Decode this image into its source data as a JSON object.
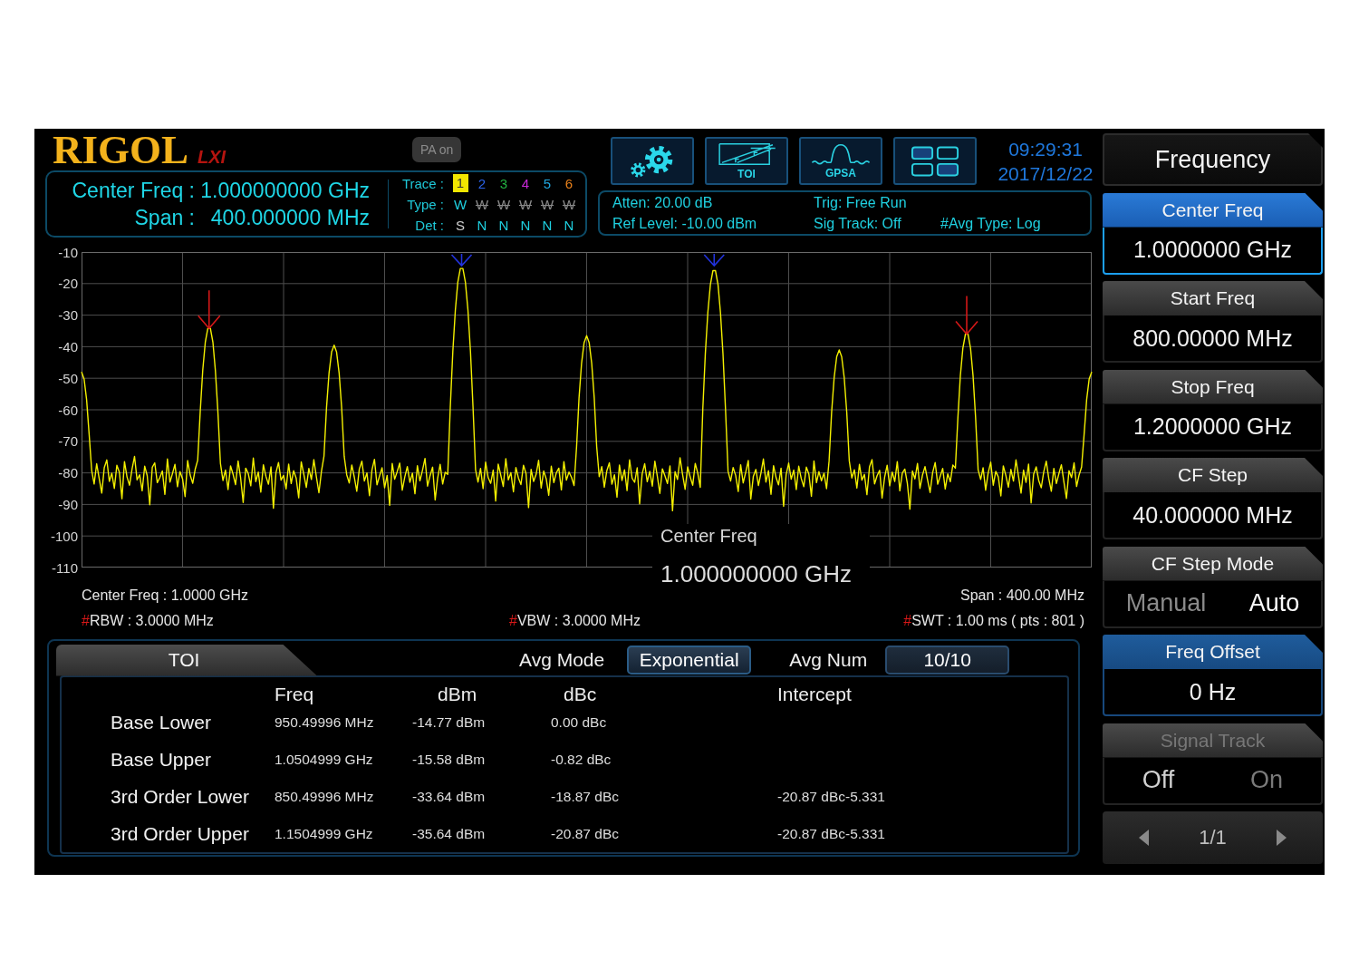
{
  "header": {
    "logo": "RIGOL",
    "logo_badge": "LXI",
    "pa_indicator": "PA on",
    "toolbar": [
      {
        "kind": "settings"
      },
      {
        "kind": "toi",
        "label": "TOI"
      },
      {
        "kind": "gpsa",
        "label": "GPSA"
      },
      {
        "kind": "layout"
      }
    ],
    "time": "09:29:31",
    "date": "2017/12/22"
  },
  "info": {
    "center_freq": {
      "label": "Center Freq :",
      "value": "1.000000000 GHz"
    },
    "span": {
      "label": "Span :",
      "value": "400.000000 MHz"
    },
    "row_labels": [
      "Trace :",
      "Type :",
      "Det :"
    ],
    "traces": [
      {
        "number": "1",
        "color": "#f2e600",
        "selected": true,
        "visible": true,
        "type": "W",
        "det": "S"
      },
      {
        "number": "2",
        "color": "#2a62e8",
        "selected": false,
        "visible": false,
        "type": "W",
        "det": "N"
      },
      {
        "number": "3",
        "color": "#22b040",
        "selected": false,
        "visible": false,
        "type": "W",
        "det": "N"
      },
      {
        "number": "4",
        "color": "#c828d8",
        "selected": false,
        "visible": false,
        "type": "W",
        "det": "N"
      },
      {
        "number": "5",
        "color": "#20a8e0",
        "selected": false,
        "visible": false,
        "type": "W",
        "det": "N"
      },
      {
        "number": "6",
        "color": "#e8801a",
        "selected": false,
        "visible": false,
        "type": "W",
        "det": "N"
      }
    ],
    "status": [
      [
        "Atten: 20.00 dB",
        "Ref Level: -10.00 dBm"
      ],
      [
        "Trig: Free Run",
        "Sig Track: Off"
      ],
      [
        "#Avg Type: Log"
      ]
    ]
  },
  "plot": {
    "chart_data": {
      "type": "line",
      "grid": true,
      "ylim": [
        -110,
        -10
      ],
      "yticks": [
        -10,
        -20,
        -30,
        -40,
        -50,
        -60,
        -70,
        -80,
        -90,
        -100,
        -110
      ],
      "categories": [
        null,
        null,
        null,
        null,
        null,
        null,
        null,
        null,
        null,
        null,
        null,
        null,
        null,
        null,
        null,
        null,
        null,
        null,
        null,
        null,
        null,
        null,
        null,
        null,
        null,
        null,
        null,
        null,
        null,
        null,
        null,
        null,
        null,
        null,
        null,
        null,
        null,
        null,
        null,
        null,
        null,
        null,
        null,
        null,
        null,
        null,
        null,
        null,
        null,
        null,
        null,
        null,
        null,
        null,
        null,
        null,
        null,
        null,
        null,
        null,
        null,
        null,
        null,
        null,
        null,
        null,
        null,
        null,
        null,
        null,
        null,
        null,
        null,
        null,
        null,
        null,
        null,
        null,
        null,
        null,
        null,
        null,
        null,
        null,
        null,
        null,
        null,
        null,
        null,
        null,
        null,
        null,
        null,
        null,
        null,
        null,
        null,
        null,
        null,
        null,
        null,
        null,
        null,
        null,
        null,
        null,
        null,
        null,
        null,
        null,
        null,
        null,
        null,
        null,
        null,
        null,
        null,
        null,
        null,
        null,
        null,
        null,
        null,
        null,
        null,
        null,
        null,
        null,
        null,
        null,
        null,
        null,
        null,
        null,
        null,
        null,
        null,
        null,
        null,
        null,
        null,
        null,
        null,
        null,
        null,
        null,
        null,
        null,
        null,
        null,
        null,
        null,
        null,
        null,
        null,
        null,
        null,
        null,
        null,
        null,
        null,
        null,
        null,
        null,
        null,
        null,
        null,
        null,
        null,
        null,
        null,
        null,
        null,
        null,
        null,
        null,
        null,
        null,
        null,
        null,
        null,
        null,
        null,
        null,
        null,
        null,
        null,
        null,
        null,
        null,
        null,
        null,
        null,
        null,
        null,
        null,
        null,
        null,
        null,
        null,
        null,
        null,
        null,
        null,
        null,
        null,
        null,
        null,
        null,
        null,
        null,
        null,
        null,
        null,
        null,
        null,
        null,
        null,
        null,
        null,
        null,
        null,
        null,
        null,
        null,
        null,
        null,
        null,
        null,
        null,
        null,
        null,
        null,
        null,
        null,
        null,
        null,
        null,
        null,
        null,
        null,
        null,
        null,
        null,
        null,
        null,
        null,
        null,
        null,
        null,
        null,
        null,
        null,
        null,
        null,
        null,
        null,
        null,
        null,
        null,
        null,
        null,
        null,
        null,
        null,
        null,
        null,
        null,
        null,
        null,
        null,
        null,
        null,
        null,
        null,
        null,
        null,
        null,
        null,
        null,
        null,
        null,
        null,
        null,
        null,
        null,
        null,
        null,
        null,
        null,
        null,
        null,
        null,
        null,
        null,
        null,
        null,
        null,
        null,
        null,
        null,
        null,
        null,
        null,
        null,
        null,
        null,
        null,
        null,
        null,
        null,
        null,
        null,
        null,
        null,
        null,
        null,
        null,
        null,
        null,
        null,
        null,
        null,
        null,
        null,
        null,
        null,
        null,
        null,
        null,
        null,
        null,
        null,
        null,
        null,
        null,
        null,
        null,
        null,
        null,
        null,
        null,
        null,
        null,
        null,
        null,
        null,
        null,
        null,
        null,
        null,
        null,
        null,
        null,
        null,
        null,
        null,
        null,
        null,
        null,
        null,
        null,
        null,
        null,
        null,
        null,
        null,
        null,
        null,
        null,
        null,
        null,
        null,
        null,
        null,
        null,
        null,
        null,
        null,
        null,
        null,
        null,
        null,
        null,
        null,
        null,
        null,
        null,
        null,
        null,
        null,
        null,
        null,
        null,
        null,
        null,
        null,
        null,
        null,
        null,
        null
      ],
      "series": [
        {
          "color": "#f4f000",
          "values": [
            -48,
            -50.2,
            -56.8,
            -67.8,
            -79.2,
            -83.5,
            -77.1,
            -81.8,
            -86.4,
            -78.3,
            -75.9,
            -82.7,
            -80.1,
            -84.9,
            -77.6,
            -79.8,
            -88.2,
            -76.4,
            -81.3,
            -83.9,
            -78.7,
            -74.8,
            -82.2,
            -80.6,
            -85.7,
            -77.9,
            -80.9,
            -90.1,
            -78.2,
            -76.8,
            -83.1,
            -81.5,
            -79.4,
            -86.8,
            -75.6,
            -82.9,
            -80.3,
            -77.3,
            -84.4,
            -79.6,
            -81.9,
            -87.5,
            -76.1,
            -80.7,
            -83.3,
            -78.9,
            -76,
            -60.6,
            -47.4,
            -38.6,
            -34.2,
            -34.2,
            -38.6,
            -47.4,
            -60.6,
            -77,
            -82.4,
            -79.1,
            -85.3,
            -77.8,
            -80.5,
            -83.7,
            -76.2,
            -81.6,
            -89.4,
            -78.5,
            -80.2,
            -84.1,
            -75.3,
            -82.8,
            -79.7,
            -86.1,
            -77.4,
            -81.1,
            -83.6,
            -78.1,
            -91.2,
            -79.9,
            -76.7,
            -82.3,
            -80.8,
            -85.1,
            -77.2,
            -83.4,
            -79.3,
            -81.7,
            -87.9,
            -76.5,
            -80.4,
            -84.6,
            -78.6,
            -82.1,
            -75.8,
            -81.2,
            -86.3,
            -79.5,
            -74.7,
            -59.3,
            -48.3,
            -41.7,
            -39.5,
            -41.7,
            -48.3,
            -59.3,
            -74.7,
            -80.6,
            -83.2,
            -77.5,
            -81.4,
            -85.8,
            -78.8,
            -76.3,
            -82.6,
            -80.0,
            -87.2,
            -79.0,
            -75.7,
            -83.8,
            -81.0,
            -78.4,
            -84.7,
            -80.8,
            -90.3,
            -77.0,
            -82.0,
            -79.6,
            -76.9,
            -85.5,
            -81.3,
            -78.0,
            -83.0,
            -80.1,
            -86.6,
            -77.7,
            -82.5,
            -79.2,
            -75.4,
            -84.2,
            -80.9,
            -78.2,
            -88.6,
            -81.8,
            -77.3,
            -83.5,
            -79.8,
            -80.5,
            -59.2,
            -41.6,
            -28.4,
            -19.6,
            -15.2,
            -15.2,
            -19.6,
            -28.4,
            -41.6,
            -59.2,
            -79,
            -82.9,
            -78.6,
            -85.0,
            -76.6,
            -81.5,
            -83.3,
            -79.1,
            -88.9,
            -77.2,
            -80.7,
            -84.3,
            -75.5,
            -82.2,
            -79.9,
            -86.0,
            -78.3,
            -81.6,
            -83.7,
            -77.6,
            -80.2,
            -91.0,
            -78.9,
            -82.7,
            -80.4,
            -76.0,
            -84.8,
            -79.4,
            -81.9,
            -87.1,
            -77.9,
            -83.1,
            -80.0,
            -78.5,
            -85.4,
            -76.4,
            -82.3,
            -79.7,
            -81.4,
            -84.0,
            -71.7,
            -56.3,
            -45.3,
            -38.7,
            -36.5,
            -38.7,
            -45.3,
            -56.3,
            -71.7,
            -81.2,
            -78.0,
            -84.5,
            -79.3,
            -76.8,
            -83.6,
            -80.6,
            -87.7,
            -77.5,
            -82.4,
            -79.0,
            -85.6,
            -75.9,
            -81.7,
            -83.0,
            -78.4,
            -89.8,
            -80.3,
            -77.1,
            -82.8,
            -79.5,
            -84.2,
            -76.3,
            -81.0,
            -86.5,
            -78.7,
            -80.9,
            -83.4,
            -77.8,
            -92.0,
            -79.6,
            -82.1,
            -75.2,
            -80.5,
            -85.2,
            -78.1,
            -81.3,
            -83.9,
            -77.0,
            -80.0,
            -84.6,
            -59.9,
            -42.3,
            -29.1,
            -20.3,
            -15.9,
            -15.9,
            -20.3,
            -29.1,
            -42.3,
            -59.9,
            -79.5,
            -82.6,
            -78.3,
            -80.8,
            -85.9,
            -77.4,
            -83.2,
            -79.8,
            -76.1,
            -88.3,
            -81.1,
            -78.9,
            -84.0,
            -80.2,
            -75.6,
            -82.9,
            -79.3,
            -86.8,
            -77.7,
            -81.5,
            -83.8,
            -78.5,
            -90.6,
            -80.6,
            -76.9,
            -82.0,
            -79.1,
            -85.3,
            -77.9,
            -81.8,
            -84.4,
            -78.2,
            -80.4,
            -87.4,
            -76.2,
            -83.1,
            -79.6,
            -82.5,
            -80.1,
            -85.0,
            -76.2,
            -60.8,
            -49.8,
            -43.2,
            -41.0,
            -43.2,
            -49.8,
            -60.8,
            -76.2,
            -81.6,
            -79.0,
            -84.8,
            -77.3,
            -82.3,
            -80.5,
            -86.9,
            -78.1,
            -75.8,
            -83.5,
            -80.9,
            -79.2,
            -88.0,
            -81.4,
            -77.6,
            -84.1,
            -79.7,
            -82.7,
            -76.4,
            -85.7,
            -80.1,
            -78.8,
            -83.3,
            -91.5,
            -79.4,
            -81.9,
            -77.0,
            -84.9,
            -80.7,
            -78.0,
            -82.2,
            -86.2,
            -79.9,
            -76.7,
            -83.6,
            -81.0,
            -78.6,
            -85.1,
            -80.3,
            -82.8,
            -77.5,
            -78.5,
            -62.4,
            -49.2,
            -40.4,
            -36.0,
            -36.0,
            -40.4,
            -49.2,
            -62.4,
            -79,
            -82.1,
            -78.4,
            -85.5,
            -80.0,
            -76.6,
            -83.9,
            -79.5,
            -81.3,
            -87.3,
            -77.8,
            -80.8,
            -84.5,
            -78.9,
            -82.6,
            -75.9,
            -81.1,
            -86.4,
            -79.1,
            -83.0,
            -77.2,
            -89.5,
            -80.4,
            -78.1,
            -82.4,
            -84.7,
            -79.7,
            -76.3,
            -81.8,
            -85.8,
            -78.6,
            -83.4,
            -80.2,
            -77.4,
            -82.9,
            -88.1,
            -79.3,
            -81.5,
            -76.8,
            -84.3,
            -80.6,
            -78.2,
            -67.8,
            -56.8,
            -50.2,
            -48.0
          ]
        }
      ]
    },
    "popup": {
      "label": "Center Freq",
      "value": "1.000000000 GHz"
    },
    "footer": {
      "center_freq": "Center Freq : 1.0000 GHz",
      "span": "Span : 400.00 MHz",
      "rbw": {
        "flag": "#",
        "text": "RBW : 3.0000 MHz"
      },
      "vbw": {
        "flag": "#",
        "text": "VBW : 3.0000 MHz"
      },
      "swt": {
        "flag": "#",
        "text": "SWT : 1.00 ms ( pts : 801 )"
      }
    }
  },
  "measurement": {
    "tab": "TOI",
    "avg_mode": {
      "label": "Avg Mode",
      "value": "Exponential"
    },
    "avg_num": {
      "label": "Avg Num",
      "value": "10/10"
    },
    "columns": [
      "Freq",
      "dBm",
      "dBc",
      "Intercept"
    ],
    "rows": [
      {
        "label": "Base Lower",
        "cells": [
          "950.49996 MHz",
          "-14.77 dBm",
          "0.00 dBc"
        ]
      },
      {
        "label": "Base Upper",
        "cells": [
          "1.0504999 GHz",
          "-15.58 dBm",
          "-0.82 dBc"
        ]
      },
      {
        "label": "3rd Order Lower",
        "cells": [
          "850.49996 MHz",
          "-33.64 dBm",
          "-18.87 dBc",
          "-20.87 dBc-5.331"
        ]
      },
      {
        "label": "3rd Order Upper",
        "cells": [
          "1.1504999 GHz",
          "-35.64 dBm",
          "-20.87 dBc",
          "-20.87 dBc-5.331"
        ]
      }
    ]
  },
  "softkeys": {
    "title": "Frequency",
    "keys": [
      {
        "kind": "value",
        "label": "Center Freq",
        "value": "1.0000000 GHz",
        "selected": true,
        "highlighted": true,
        "disabled": false
      },
      {
        "kind": "value",
        "label": "Start Freq",
        "value": "800.00000 MHz",
        "selected": false,
        "highlighted": false,
        "disabled": false
      },
      {
        "kind": "value",
        "label": "Stop Freq",
        "value": "1.2000000 GHz",
        "selected": false,
        "highlighted": false,
        "disabled": false
      },
      {
        "kind": "value",
        "label": "CF Step",
        "value": "40.000000 MHz",
        "selected": false,
        "highlighted": false,
        "disabled": false
      },
      {
        "kind": "toggle",
        "label": "CF Step Mode",
        "options": [
          {
            "label": "Manual",
            "selected": false
          },
          {
            "label": "Auto",
            "selected": true
          }
        ],
        "selected": false,
        "highlighted": false,
        "disabled": false
      },
      {
        "kind": "value",
        "label": "Freq Offset",
        "value": "0 Hz",
        "selected": false,
        "highlighted": true,
        "disabled": false
      },
      {
        "kind": "toggle",
        "label": "Signal Track",
        "options": [
          {
            "label": "Off",
            "selected": true
          },
          {
            "label": "On",
            "selected": false
          }
        ],
        "selected": false,
        "highlighted": false,
        "disabled": true
      }
    ],
    "page": "1/1"
  }
}
